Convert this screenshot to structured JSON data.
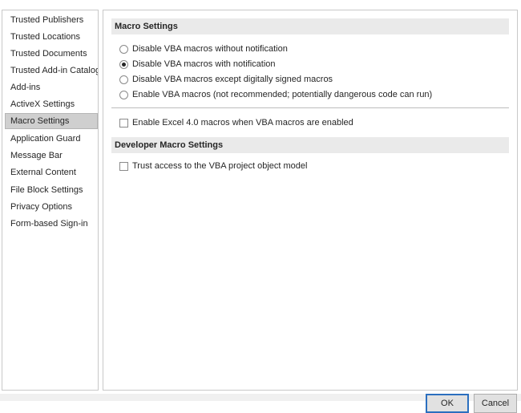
{
  "sidebar": {
    "items": [
      {
        "label": "Trusted Publishers",
        "selected": false
      },
      {
        "label": "Trusted Locations",
        "selected": false
      },
      {
        "label": "Trusted Documents",
        "selected": false
      },
      {
        "label": "Trusted Add-in Catalogs",
        "selected": false
      },
      {
        "label": "Add-ins",
        "selected": false
      },
      {
        "label": "ActiveX Settings",
        "selected": false
      },
      {
        "label": "Macro Settings",
        "selected": true
      },
      {
        "label": "Application Guard",
        "selected": false
      },
      {
        "label": "Message Bar",
        "selected": false
      },
      {
        "label": "External Content",
        "selected": false
      },
      {
        "label": "File Block Settings",
        "selected": false
      },
      {
        "label": "Privacy Options",
        "selected": false
      },
      {
        "label": "Form-based Sign-in",
        "selected": false
      }
    ]
  },
  "macro_settings": {
    "header": "Macro Settings",
    "radio_options": [
      {
        "label": "Disable VBA macros without notification",
        "checked": false
      },
      {
        "label": "Disable VBA macros with notification",
        "checked": true
      },
      {
        "label": "Disable VBA macros except digitally signed macros",
        "checked": false
      },
      {
        "label": "Enable VBA macros (not recommended; potentially dangerous code can run)",
        "checked": false
      }
    ],
    "excel4_checkbox": {
      "label": "Enable Excel 4.0 macros when VBA macros are enabled",
      "checked": false
    }
  },
  "developer_settings": {
    "header": "Developer Macro Settings",
    "trust_vba_checkbox": {
      "label": "Trust access to the VBA project object model",
      "checked": false
    }
  },
  "buttons": {
    "ok": "OK",
    "cancel": "Cancel"
  }
}
